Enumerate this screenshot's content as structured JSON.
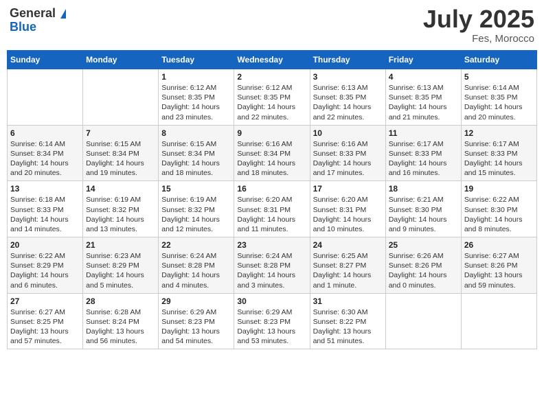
{
  "header": {
    "logo_general": "General",
    "logo_blue": "Blue",
    "month_year": "July 2025",
    "location": "Fes, Morocco"
  },
  "weekdays": [
    "Sunday",
    "Monday",
    "Tuesday",
    "Wednesday",
    "Thursday",
    "Friday",
    "Saturday"
  ],
  "weeks": [
    [
      {
        "day": "",
        "info": ""
      },
      {
        "day": "",
        "info": ""
      },
      {
        "day": "1",
        "info": "Sunrise: 6:12 AM\nSunset: 8:35 PM\nDaylight: 14 hours and 23 minutes."
      },
      {
        "day": "2",
        "info": "Sunrise: 6:12 AM\nSunset: 8:35 PM\nDaylight: 14 hours and 22 minutes."
      },
      {
        "day": "3",
        "info": "Sunrise: 6:13 AM\nSunset: 8:35 PM\nDaylight: 14 hours and 22 minutes."
      },
      {
        "day": "4",
        "info": "Sunrise: 6:13 AM\nSunset: 8:35 PM\nDaylight: 14 hours and 21 minutes."
      },
      {
        "day": "5",
        "info": "Sunrise: 6:14 AM\nSunset: 8:35 PM\nDaylight: 14 hours and 20 minutes."
      }
    ],
    [
      {
        "day": "6",
        "info": "Sunrise: 6:14 AM\nSunset: 8:34 PM\nDaylight: 14 hours and 20 minutes."
      },
      {
        "day": "7",
        "info": "Sunrise: 6:15 AM\nSunset: 8:34 PM\nDaylight: 14 hours and 19 minutes."
      },
      {
        "day": "8",
        "info": "Sunrise: 6:15 AM\nSunset: 8:34 PM\nDaylight: 14 hours and 18 minutes."
      },
      {
        "day": "9",
        "info": "Sunrise: 6:16 AM\nSunset: 8:34 PM\nDaylight: 14 hours and 18 minutes."
      },
      {
        "day": "10",
        "info": "Sunrise: 6:16 AM\nSunset: 8:33 PM\nDaylight: 14 hours and 17 minutes."
      },
      {
        "day": "11",
        "info": "Sunrise: 6:17 AM\nSunset: 8:33 PM\nDaylight: 14 hours and 16 minutes."
      },
      {
        "day": "12",
        "info": "Sunrise: 6:17 AM\nSunset: 8:33 PM\nDaylight: 14 hours and 15 minutes."
      }
    ],
    [
      {
        "day": "13",
        "info": "Sunrise: 6:18 AM\nSunset: 8:33 PM\nDaylight: 14 hours and 14 minutes."
      },
      {
        "day": "14",
        "info": "Sunrise: 6:19 AM\nSunset: 8:32 PM\nDaylight: 14 hours and 13 minutes."
      },
      {
        "day": "15",
        "info": "Sunrise: 6:19 AM\nSunset: 8:32 PM\nDaylight: 14 hours and 12 minutes."
      },
      {
        "day": "16",
        "info": "Sunrise: 6:20 AM\nSunset: 8:31 PM\nDaylight: 14 hours and 11 minutes."
      },
      {
        "day": "17",
        "info": "Sunrise: 6:20 AM\nSunset: 8:31 PM\nDaylight: 14 hours and 10 minutes."
      },
      {
        "day": "18",
        "info": "Sunrise: 6:21 AM\nSunset: 8:30 PM\nDaylight: 14 hours and 9 minutes."
      },
      {
        "day": "19",
        "info": "Sunrise: 6:22 AM\nSunset: 8:30 PM\nDaylight: 14 hours and 8 minutes."
      }
    ],
    [
      {
        "day": "20",
        "info": "Sunrise: 6:22 AM\nSunset: 8:29 PM\nDaylight: 14 hours and 6 minutes."
      },
      {
        "day": "21",
        "info": "Sunrise: 6:23 AM\nSunset: 8:29 PM\nDaylight: 14 hours and 5 minutes."
      },
      {
        "day": "22",
        "info": "Sunrise: 6:24 AM\nSunset: 8:28 PM\nDaylight: 14 hours and 4 minutes."
      },
      {
        "day": "23",
        "info": "Sunrise: 6:24 AM\nSunset: 8:28 PM\nDaylight: 14 hours and 3 minutes."
      },
      {
        "day": "24",
        "info": "Sunrise: 6:25 AM\nSunset: 8:27 PM\nDaylight: 14 hours and 1 minute."
      },
      {
        "day": "25",
        "info": "Sunrise: 6:26 AM\nSunset: 8:26 PM\nDaylight: 14 hours and 0 minutes."
      },
      {
        "day": "26",
        "info": "Sunrise: 6:27 AM\nSunset: 8:26 PM\nDaylight: 13 hours and 59 minutes."
      }
    ],
    [
      {
        "day": "27",
        "info": "Sunrise: 6:27 AM\nSunset: 8:25 PM\nDaylight: 13 hours and 57 minutes."
      },
      {
        "day": "28",
        "info": "Sunrise: 6:28 AM\nSunset: 8:24 PM\nDaylight: 13 hours and 56 minutes."
      },
      {
        "day": "29",
        "info": "Sunrise: 6:29 AM\nSunset: 8:23 PM\nDaylight: 13 hours and 54 minutes."
      },
      {
        "day": "30",
        "info": "Sunrise: 6:29 AM\nSunset: 8:23 PM\nDaylight: 13 hours and 53 minutes."
      },
      {
        "day": "31",
        "info": "Sunrise: 6:30 AM\nSunset: 8:22 PM\nDaylight: 13 hours and 51 minutes."
      },
      {
        "day": "",
        "info": ""
      },
      {
        "day": "",
        "info": ""
      }
    ]
  ]
}
